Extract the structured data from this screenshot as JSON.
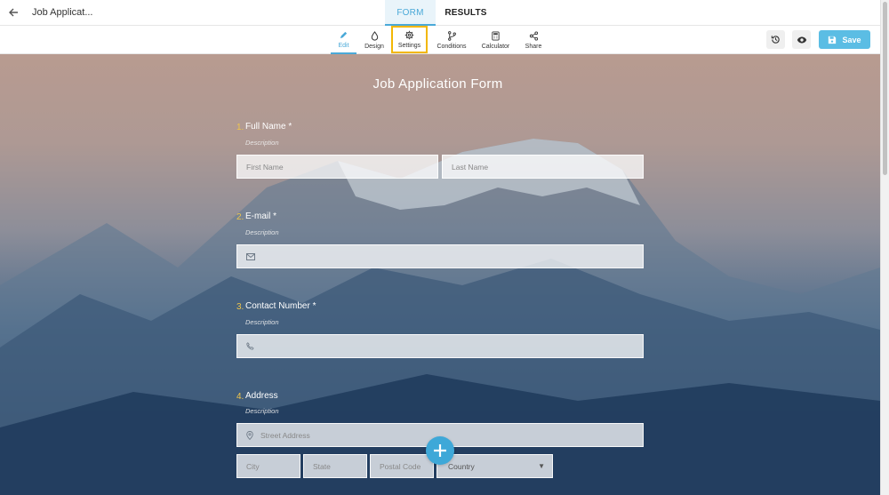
{
  "header": {
    "doc_title": "Job Applicat...",
    "tabs": [
      {
        "label": "FORM",
        "active": true
      },
      {
        "label": "RESULTS",
        "active": false
      }
    ]
  },
  "toolbar": {
    "items": [
      {
        "label": "Edit",
        "icon": "pencil-icon",
        "active": true
      },
      {
        "label": "Design",
        "icon": "droplet-icon"
      },
      {
        "label": "Settings",
        "icon": "gear-icon",
        "highlighted": true
      },
      {
        "label": "Conditions",
        "icon": "branch-icon"
      },
      {
        "label": "Calculator",
        "icon": "calculator-icon"
      },
      {
        "label": "Share",
        "icon": "share-icon"
      }
    ],
    "save_label": "Save"
  },
  "form": {
    "title": "Job Application Form",
    "questions": [
      {
        "number": "1.",
        "label": "Full Name",
        "required": "*",
        "description": "Description",
        "placeholders": [
          "First Name",
          "Last Name"
        ]
      },
      {
        "number": "2.",
        "label": "E-mail",
        "required": "*",
        "description": "Description",
        "icon": "envelope-icon"
      },
      {
        "number": "3.",
        "label": "Contact Number",
        "required": "*",
        "description": "Description",
        "icon": "phone-icon"
      },
      {
        "number": "4.",
        "label": "Address",
        "required": "",
        "description": "Description",
        "street_placeholder": "Street Address",
        "sub_fields": [
          "City",
          "State",
          "Postal Code"
        ],
        "country_value": "Country"
      }
    ]
  },
  "colors": {
    "accent": "#4aa9d8",
    "save": "#5bbde4",
    "highlight": "#f2b705",
    "question_number": "#f0c54a"
  }
}
